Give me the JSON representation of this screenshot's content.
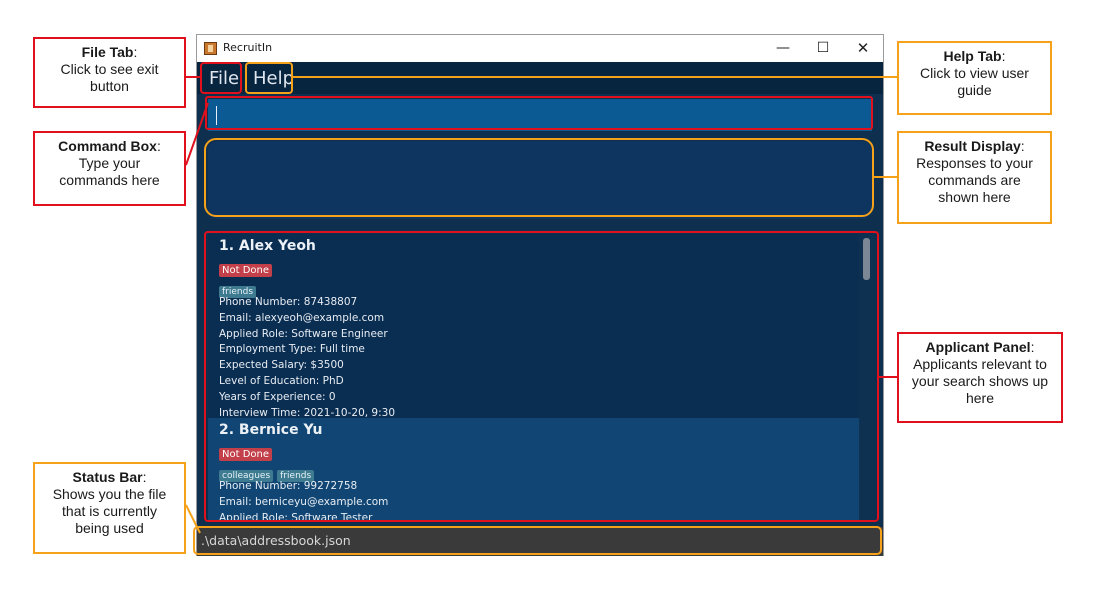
{
  "window": {
    "title": "RecruitIn",
    "controls": {
      "minimize": "—",
      "maximize": "☐",
      "close": "✕"
    }
  },
  "menu": {
    "file": "File",
    "help": "Help"
  },
  "command_box": {
    "value": ""
  },
  "result_display": {
    "text": ""
  },
  "applicants": [
    {
      "index_name": "1.  Alex Yeoh",
      "status": "Not Done",
      "tags": [
        "friends"
      ],
      "fields": [
        "Phone Number: 87438807",
        "Email: alexyeoh@example.com",
        "Applied Role: Software Engineer",
        "Employment Type: Full time",
        "Expected Salary: $3500",
        "Level of Education: PhD",
        "Years of Experience: 0",
        "Interview Time: 2021-10-20, 9:30"
      ]
    },
    {
      "index_name": "2.  Bernice Yu",
      "status": "Not Done",
      "tags": [
        "colleagues",
        "friends"
      ],
      "fields": [
        "Phone Number: 99272758",
        "Email: berniceyu@example.com",
        "Applied Role: Software Tester"
      ]
    }
  ],
  "status_bar": {
    "text": ".\\data\\addressbook.json"
  },
  "callouts": {
    "file_tab": {
      "title": "File Tab",
      "desc": "Click to see exit button"
    },
    "command_box": {
      "title": "Command Box",
      "desc": "Type your commands here"
    },
    "status_bar": {
      "title": "Status Bar",
      "desc": "Shows you the file that is currently being used"
    },
    "help_tab": {
      "title": "Help Tab",
      "desc": "Click to view user guide"
    },
    "result_display": {
      "title": "Result Display",
      "desc": "Responses to your commands are shown here"
    },
    "applicant_panel": {
      "title": "Applicant Panel",
      "desc": "Applicants relevant to your search shows up here"
    }
  },
  "colors": {
    "red": "#e0111c",
    "orange": "#f5a11a",
    "window_bg": "#0f2f4f"
  }
}
